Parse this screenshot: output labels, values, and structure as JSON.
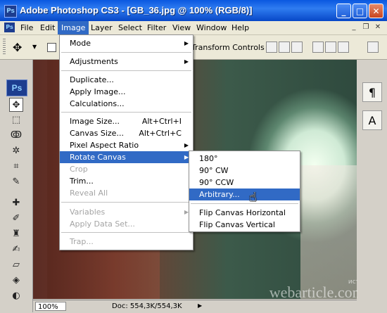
{
  "window": {
    "title": "Adobe Photoshop CS3 - [GB_36.jpg @ 100% (RGB/8)]",
    "app_icon": "Ps"
  },
  "window_buttons": {
    "minimize": "_",
    "maximize": "□",
    "close": "✕"
  },
  "menubar": {
    "items": [
      "File",
      "Edit",
      "Image",
      "Layer",
      "Select",
      "Filter",
      "View",
      "Window",
      "Help"
    ],
    "active": "Image",
    "doc_controls": [
      "_",
      "❐",
      "✕"
    ]
  },
  "options_bar": {
    "transform_controls_label": "Transform Controls"
  },
  "toolbar": {
    "logo": "Ps"
  },
  "image_menu": {
    "mode": "Mode",
    "adjustments": "Adjustments",
    "duplicate": "Duplicate...",
    "apply_image": "Apply Image...",
    "calculations": "Calculations...",
    "image_size": "Image Size...",
    "image_size_sc": "Alt+Ctrl+I",
    "canvas_size": "Canvas Size...",
    "canvas_size_sc": "Alt+Ctrl+C",
    "pixel_aspect_ratio": "Pixel Aspect Ratio",
    "rotate_canvas": "Rotate Canvas",
    "crop": "Crop",
    "trim": "Trim...",
    "reveal_all": "Reveal All",
    "variables": "Variables",
    "apply_data_set": "Apply Data Set...",
    "trap": "Trap..."
  },
  "rotate_menu": {
    "r180": "180°",
    "r90cw": "90° CW",
    "r90ccw": "90° CCW",
    "arbitrary": "Arbitrary...",
    "flip_h": "Flip Canvas Horizontal",
    "flip_v": "Flip Canvas Vertical"
  },
  "status_bar": {
    "zoom": "100%",
    "doc_info": "Doc: 554,3K/554,3K"
  },
  "watermark": {
    "source_label": "источник:",
    "site": "webarticle.com.ua"
  },
  "right_panel": {
    "paragraph_icon": "¶",
    "character_icon": "A"
  }
}
